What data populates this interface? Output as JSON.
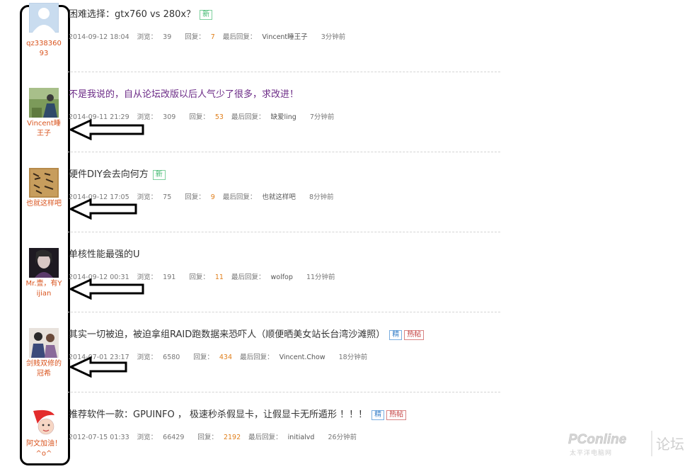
{
  "labels": {
    "views": "浏览：",
    "replies": "回复：",
    "last_reply": "最后回复："
  },
  "badges": {
    "new": "新",
    "jing": "精",
    "hot": "热帖"
  },
  "threads": [
    {
      "username": "qz33836093",
      "title": "困难选择：gtx760 vs 280x？",
      "date": "2014-09-12 18:04",
      "views": "39",
      "replies": "7",
      "last_user": "Vincent睡王子",
      "ago": "3分钟前",
      "arrow": false
    },
    {
      "username": "Vincent睡王子",
      "title": "不是我说的，自从论坛改版以后人气少了很多，求改进！",
      "date": "2014-09-11 21:29",
      "views": "309",
      "replies": "53",
      "last_user": "缺爱ling",
      "ago": "7分钟前",
      "arrow": true
    },
    {
      "username": "也就这样吧",
      "title": "硬件DIY会去向何方",
      "date": "2014-09-12 17:05",
      "views": "75",
      "replies": "9",
      "last_user": "也就这样吧",
      "ago": "8分钟前",
      "arrow": true
    },
    {
      "username": "Mr.壹，有Yijian",
      "title": "单核性能最强的U",
      "date": "2014-09-12 00:31",
      "views": "191",
      "replies": "11",
      "last_user": "wolfop",
      "ago": "11分钟前",
      "arrow": true
    },
    {
      "username": "剑贱双修的冠希",
      "title": "其实一切被迫，被迫拿组RAID跑数据来恐吓人（顺便晒美女站长台湾沙滩照）",
      "date": "2014-07-01 23:17",
      "views": "6580",
      "replies": "434",
      "last_user": "Vincent.Chow",
      "ago": "18分钟前",
      "arrow": true
    },
    {
      "username": "阿文加油！^o^",
      "title": "推荐软件一款：GPUINFO ， 极速秒杀假显卡，让假显卡无所遁形 ！！！",
      "date": "2012-07-15 01:33",
      "views": "66429",
      "replies": "2192",
      "last_user": "initialvd",
      "ago": "26分钟前",
      "arrow": false
    }
  ],
  "watermark": {
    "brand": "PConline",
    "tagline": "太平洋电脑网",
    "section": "论坛"
  },
  "colors": {
    "username": "#d9541e",
    "count_highlight": "#e07f1b",
    "visited_title": "#6b2a86",
    "badge_new": "#3fb86e",
    "badge_jing": "#3b82c9",
    "badge_hot": "#c23b3b"
  }
}
